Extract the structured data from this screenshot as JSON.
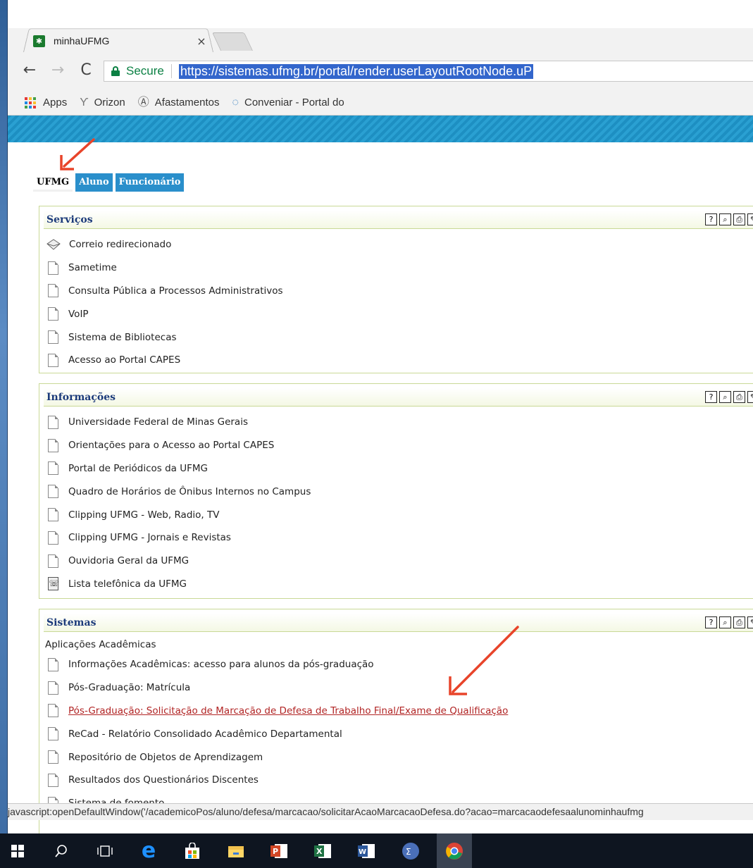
{
  "browser": {
    "tab_title": "minhaUFMG",
    "tab_close": "×",
    "secure_label": "Secure",
    "url": "https://sistemas.ufmg.br/portal/render.userLayoutRootNode.uP",
    "bookmarks": [
      {
        "label": "Apps",
        "icon": "apps-grid-icon"
      },
      {
        "label": "Orizon",
        "icon": "orizon-icon"
      },
      {
        "label": "Afastamentos",
        "icon": "afastamentos-icon"
      },
      {
        "label": "Conveniar - Portal do",
        "icon": "conveniar-icon"
      }
    ],
    "status_text": "javascript:openDefaultWindow('/academicoPos/aluno/defesa/marcacao/solicitarAcaoMarcacaoDefesa.do?acao=marcacaodefesaalunominhaufmg"
  },
  "portal": {
    "tabs": [
      {
        "label": "UFMG",
        "active": true
      },
      {
        "label": "Aluno",
        "active": false
      },
      {
        "label": "Funcionário",
        "active": false
      }
    ],
    "channels": [
      {
        "title": "Serviços",
        "items": [
          {
            "label": "Correio redirecionado",
            "icon": "mail-icon"
          },
          {
            "label": "Sametime",
            "icon": "document-icon"
          },
          {
            "label": "Consulta Pública a Processos Administrativos",
            "icon": "document-icon"
          },
          {
            "label": "VoIP",
            "icon": "document-icon"
          },
          {
            "label": "Sistema de Bibliotecas",
            "icon": "document-icon"
          },
          {
            "label": "Acesso ao Portal CAPES",
            "icon": "document-icon"
          }
        ]
      },
      {
        "title": "Informações",
        "items": [
          {
            "label": "Universidade Federal de Minas Gerais",
            "icon": "document-icon"
          },
          {
            "label": "Orientações para o Acesso ao Portal CAPES",
            "icon": "document-icon"
          },
          {
            "label": "Portal de Periódicos da UFMG",
            "icon": "document-icon"
          },
          {
            "label": "Quadro de Horários de Ônibus Internos no Campus",
            "icon": "document-icon"
          },
          {
            "label": "Clipping UFMG - Web, Radio, TV",
            "icon": "document-icon"
          },
          {
            "label": "Clipping UFMG - Jornais e Revistas",
            "icon": "document-icon"
          },
          {
            "label": "Ouvidoria Geral da UFMG",
            "icon": "document-icon"
          },
          {
            "label": "Lista telefônica da UFMG",
            "icon": "phone-book-icon"
          }
        ]
      },
      {
        "title": "Sistemas",
        "subheading": "Aplicações Acadêmicas",
        "items": [
          {
            "label": "Informações Acadêmicas: acesso para alunos da pós-graduação",
            "icon": "document-icon"
          },
          {
            "label": "Pós-Graduação: Matrícula",
            "icon": "document-icon"
          },
          {
            "label": "Pós-Graduação: Solicitação de Marcação de Defesa de Trabalho Final/Exame de Qualificação",
            "icon": "document-icon",
            "hovered": true
          },
          {
            "label": "ReCad - Relatório Consolidado Acadêmico Departamental",
            "icon": "document-icon"
          },
          {
            "label": "Repositório de Objetos de Aprendizagem",
            "icon": "document-icon"
          },
          {
            "label": "Resultados dos Questionários Discentes",
            "icon": "document-icon"
          },
          {
            "label": "Sistema de fomento",
            "icon": "document-icon"
          }
        ]
      }
    ],
    "channel_tools": [
      "help-icon",
      "search-icon",
      "print-icon",
      "edit-icon"
    ]
  },
  "colors": {
    "banner": "#2aa0d2",
    "channel_border": "#c9d996",
    "channel_title": "#1b3a7a",
    "hover_link": "#b12424",
    "secure_green": "#0b8043",
    "annotation_arrow": "#e8442a"
  },
  "taskbar": [
    "windows-start-icon",
    "search-icon",
    "task-view-icon",
    "edge-icon",
    "store-icon",
    "file-explorer-icon",
    "powerpoint-icon",
    "excel-icon",
    "word-icon",
    "calculator-icon",
    "chrome-icon"
  ]
}
